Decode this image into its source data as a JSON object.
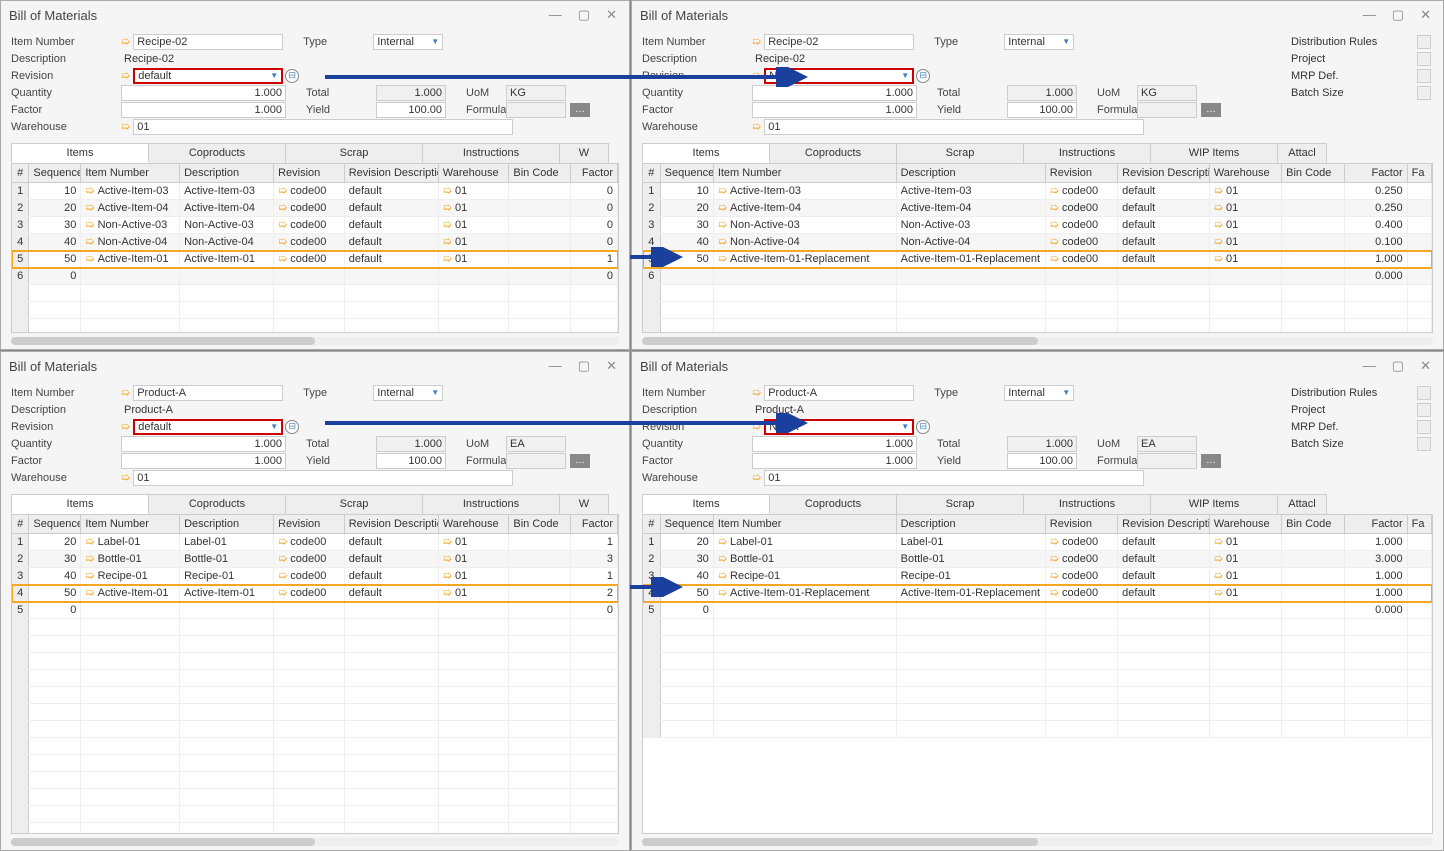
{
  "windows": [
    {
      "id": "tl",
      "title": "Bill of Materials",
      "item_number": "Recipe-02",
      "description": "Recipe-02",
      "revision": "default",
      "revision_red": true,
      "type": "Internal",
      "quantity": "1.000",
      "factor": "1.000",
      "warehouse": "01",
      "total": "1.000",
      "yield": "100.00",
      "uom": "KG",
      "formula": "",
      "wide": false,
      "distribution": false,
      "tabs": [
        "Items",
        "Coproducts",
        "Scrap",
        "Instructions",
        "W"
      ],
      "rows": [
        {
          "n": "1",
          "seq": "10",
          "item": "Active-Item-03",
          "desc": "Active-Item-03",
          "rev": "code00",
          "revdesc": "default",
          "wh": "01",
          "bin": "",
          "fact": "0"
        },
        {
          "n": "2",
          "seq": "20",
          "item": "Active-Item-04",
          "desc": "Active-Item-04",
          "rev": "code00",
          "revdesc": "default",
          "wh": "01",
          "bin": "",
          "fact": "0"
        },
        {
          "n": "3",
          "seq": "30",
          "item": "Non-Active-03",
          "desc": "Non-Active-03",
          "rev": "code00",
          "revdesc": "default",
          "wh": "01",
          "bin": "",
          "fact": "0"
        },
        {
          "n": "4",
          "seq": "40",
          "item": "Non-Active-04",
          "desc": "Non-Active-04",
          "rev": "code00",
          "revdesc": "default",
          "wh": "01",
          "bin": "",
          "fact": "0"
        },
        {
          "n": "5",
          "seq": "50",
          "item": "Active-Item-01",
          "desc": "Active-Item-01",
          "rev": "code00",
          "revdesc": "default",
          "wh": "01",
          "bin": "",
          "fact": "1",
          "hl": true
        },
        {
          "n": "6",
          "seq": "0",
          "item": "",
          "desc": "",
          "rev": "",
          "revdesc": "",
          "wh": "",
          "bin": "",
          "fact": "0",
          "empty": true
        }
      ]
    },
    {
      "id": "tr",
      "title": "Bill of Materials",
      "item_number": "Recipe-02",
      "description": "Recipe-02",
      "revision": "NewR",
      "revision_red": true,
      "type": "Internal",
      "quantity": "1.000",
      "factor": "1.000",
      "warehouse": "01",
      "total": "1.000",
      "yield": "100.00",
      "uom": "KG",
      "formula": "",
      "wide": true,
      "distribution": true,
      "dist_labels": [
        "Distribution Rules",
        "Project",
        "MRP Def.",
        "Batch Size"
      ],
      "tabs": [
        "Items",
        "Coproducts",
        "Scrap",
        "Instructions",
        "WIP Items",
        "Attacl"
      ],
      "rows": [
        {
          "n": "1",
          "seq": "10",
          "item": "Active-Item-03",
          "desc": "Active-Item-03",
          "rev": "code00",
          "revdesc": "default",
          "wh": "01",
          "bin": "",
          "fact": "0.250"
        },
        {
          "n": "2",
          "seq": "20",
          "item": "Active-Item-04",
          "desc": "Active-Item-04",
          "rev": "code00",
          "revdesc": "default",
          "wh": "01",
          "bin": "",
          "fact": "0.250"
        },
        {
          "n": "3",
          "seq": "30",
          "item": "Non-Active-03",
          "desc": "Non-Active-03",
          "rev": "code00",
          "revdesc": "default",
          "wh": "01",
          "bin": "",
          "fact": "0.400"
        },
        {
          "n": "4",
          "seq": "40",
          "item": "Non-Active-04",
          "desc": "Non-Active-04",
          "rev": "code00",
          "revdesc": "default",
          "wh": "01",
          "bin": "",
          "fact": "0.100"
        },
        {
          "n": "5",
          "seq": "50",
          "item": "Active-Item-01-Replacement",
          "desc": "Active-Item-01-Replacement",
          "rev": "code00",
          "revdesc": "default",
          "wh": "01",
          "bin": "",
          "fact": "1.000",
          "hl": true
        },
        {
          "n": "6",
          "seq": "",
          "item": "",
          "desc": "",
          "rev": "",
          "revdesc": "",
          "wh": "",
          "bin": "",
          "fact": "0.000",
          "empty": true
        }
      ]
    },
    {
      "id": "bl",
      "title": "Bill of Materials",
      "item_number": "Product-A",
      "description": "Product-A",
      "revision": "default",
      "revision_red": true,
      "type": "Internal",
      "quantity": "1.000",
      "factor": "1.000",
      "warehouse": "01",
      "total": "1.000",
      "yield": "100.00",
      "uom": "EA",
      "formula": "",
      "wide": false,
      "distribution": false,
      "tabs": [
        "Items",
        "Coproducts",
        "Scrap",
        "Instructions",
        "W"
      ],
      "rows": [
        {
          "n": "1",
          "seq": "20",
          "item": "Label-01",
          "desc": "Label-01",
          "rev": "code00",
          "revdesc": "default",
          "wh": "01",
          "bin": "",
          "fact": "1"
        },
        {
          "n": "2",
          "seq": "30",
          "item": "Bottle-01",
          "desc": "Bottle-01",
          "rev": "code00",
          "revdesc": "default",
          "wh": "01",
          "bin": "",
          "fact": "3"
        },
        {
          "n": "3",
          "seq": "40",
          "item": "Recipe-01",
          "desc": "Recipe-01",
          "rev": "code00",
          "revdesc": "default",
          "wh": "01",
          "bin": "",
          "fact": "1"
        },
        {
          "n": "4",
          "seq": "50",
          "item": "Active-Item-01",
          "desc": "Active-Item-01",
          "rev": "code00",
          "revdesc": "default",
          "wh": "01",
          "bin": "",
          "fact": "2",
          "hl": true
        },
        {
          "n": "5",
          "seq": "0",
          "item": "",
          "desc": "",
          "rev": "",
          "revdesc": "",
          "wh": "",
          "bin": "",
          "fact": "0",
          "empty": true
        }
      ]
    },
    {
      "id": "br",
      "title": "Bill of Materials",
      "item_number": "Product-A",
      "description": "Product-A",
      "revision": "NewR",
      "revision_red": true,
      "type": "Internal",
      "quantity": "1.000",
      "factor": "1.000",
      "warehouse": "01",
      "total": "1.000",
      "yield": "100.00",
      "uom": "EA",
      "formula": "",
      "wide": true,
      "distribution": true,
      "dist_labels": [
        "Distribution Rules",
        "Project",
        "MRP Def.",
        "Batch Size"
      ],
      "tabs": [
        "Items",
        "Coproducts",
        "Scrap",
        "Instructions",
        "WIP Items",
        "Attacl"
      ],
      "rows": [
        {
          "n": "1",
          "seq": "20",
          "item": "Label-01",
          "desc": "Label-01",
          "rev": "code00",
          "revdesc": "default",
          "wh": "01",
          "bin": "",
          "fact": "1.000"
        },
        {
          "n": "2",
          "seq": "30",
          "item": "Bottle-01",
          "desc": "Bottle-01",
          "rev": "code00",
          "revdesc": "default",
          "wh": "01",
          "bin": "",
          "fact": "3.000"
        },
        {
          "n": "3",
          "seq": "40",
          "item": "Recipe-01",
          "desc": "Recipe-01",
          "rev": "code00",
          "revdesc": "default",
          "wh": "01",
          "bin": "",
          "fact": "1.000"
        },
        {
          "n": "4",
          "seq": "50",
          "item": "Active-Item-01-Replacement",
          "desc": "Active-Item-01-Replacement",
          "rev": "code00",
          "revdesc": "default",
          "wh": "01",
          "bin": "",
          "fact": "1.000",
          "hl": true
        },
        {
          "n": "5",
          "seq": "0",
          "item": "",
          "desc": "",
          "rev": "",
          "revdesc": "",
          "wh": "",
          "bin": "",
          "fact": "0.000",
          "empty": true
        }
      ]
    }
  ],
  "headers": {
    "num": "#",
    "seq": "Sequence",
    "item": "Item Number",
    "desc": "Description",
    "rev": "Revision",
    "revdesc": "Revision Description",
    "wh": "Warehouse",
    "bin": "Bin Code",
    "fact": "Factor",
    "fa": "Fa"
  },
  "labels": {
    "item_number": "Item Number",
    "description": "Description",
    "revision": "Revision",
    "type": "Type",
    "quantity": "Quantity",
    "factor": "Factor",
    "warehouse": "Warehouse",
    "total": "Total",
    "yield": "Yield",
    "uom": "UoM",
    "formula": "Formula"
  }
}
